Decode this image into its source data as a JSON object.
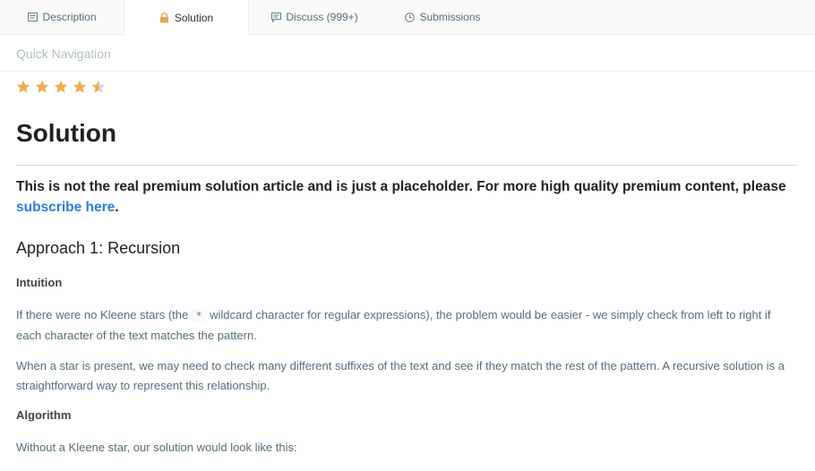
{
  "tabs": [
    {
      "label": "Description",
      "icon": "description-icon"
    },
    {
      "label": "Solution",
      "icon": "lock-icon"
    },
    {
      "label": "Discuss (999+)",
      "icon": "discuss-icon"
    },
    {
      "label": "Submissions",
      "icon": "clock-icon"
    }
  ],
  "active_tab": "Solution",
  "quick_nav": "Quick Navigation",
  "rating": {
    "value": 4.5,
    "max": 5
  },
  "colors": {
    "star": "#f0ad4e",
    "star_empty": "#d6d6d6",
    "link": "#2e7dd7",
    "lock": "#e0a458"
  },
  "article": {
    "title": "Solution",
    "notice_text": "This is not the real premium solution article and is just a placeholder. For more high quality premium content, please ",
    "notice_link": "subscribe here",
    "notice_end": ".",
    "approach_title": "Approach 1: Recursion",
    "intuition_heading": "Intuition",
    "intuition_p1_before": "If there were no Kleene stars (the ",
    "intuition_p1_code": "*",
    "intuition_p1_after": " wildcard character for regular expressions), the problem would be easier - we simply check from left to right if each character of the text matches the pattern.",
    "intuition_p2": "When a star is present, we may need to check many different suffixes of the text and see if they match the rest of the pattern. A recursive solution is a straightforward way to represent this relationship.",
    "algorithm_heading": "Algorithm",
    "algorithm_p1": "Without a Kleene star, our solution would look like this:"
  }
}
